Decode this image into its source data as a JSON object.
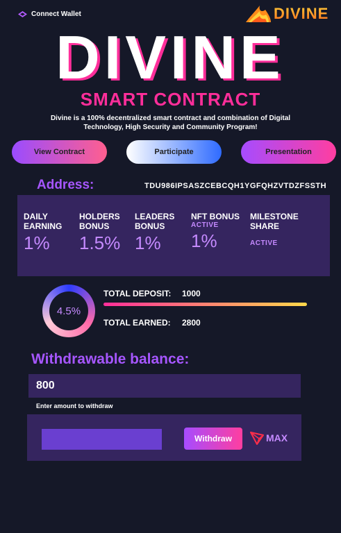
{
  "topbar": {
    "connect_label": "Connect Wallet",
    "logo_text": "DIVINE"
  },
  "hero": {
    "title": "DIVINE",
    "subtitle": "SMART CONTRACT",
    "description": "Divine is a 100% decentralized smart contract and combination of Digital Technology, High Security and Community Program!"
  },
  "buttons": {
    "view_contract": "View Contract",
    "participate": "Participate",
    "presentation": "Presentation"
  },
  "address": {
    "label": "Address:",
    "value": "TDU986IPSASZCEBCQH1YGFQHZVTDZFSSTH"
  },
  "stats": [
    {
      "title_l1": "DAILY",
      "title_l2": "EARNING",
      "value": "1%"
    },
    {
      "title_l1": "HOLDERS",
      "title_l2": "BONUS",
      "value": "1.5%"
    },
    {
      "title_l1": "LEADERS",
      "title_l2": "BONUS",
      "value": "1%"
    },
    {
      "title_l1": "NFT BONUS",
      "badge": "ACTIVE",
      "value": "1%"
    },
    {
      "title_l1": "MILESTONE",
      "title_l2": "SHARE",
      "badge": "ACTIVE"
    }
  ],
  "progress": {
    "percent_label": "4.5%",
    "total_deposit_label": "TOTAL DEPOSIT:",
    "total_deposit_value": "1000",
    "total_earned_label": "TOTAL EARNED:",
    "total_earned_value": "2800"
  },
  "withdraw": {
    "label": "Withdrawable balance:",
    "balance": "800",
    "hint": "Enter amount to withdraw",
    "input_value": "",
    "button_label": "Withdraw",
    "max_label": "MAX"
  },
  "colors": {
    "background": "#151828",
    "panel": "#35255f",
    "accent_purple": "#a656ff",
    "accent_pink": "#ff2e9a",
    "logo_orange": "#ff8a1a"
  },
  "icons": {
    "wallet": "wallet-icon",
    "logo": "flame-icon",
    "tron": "tron-icon"
  }
}
